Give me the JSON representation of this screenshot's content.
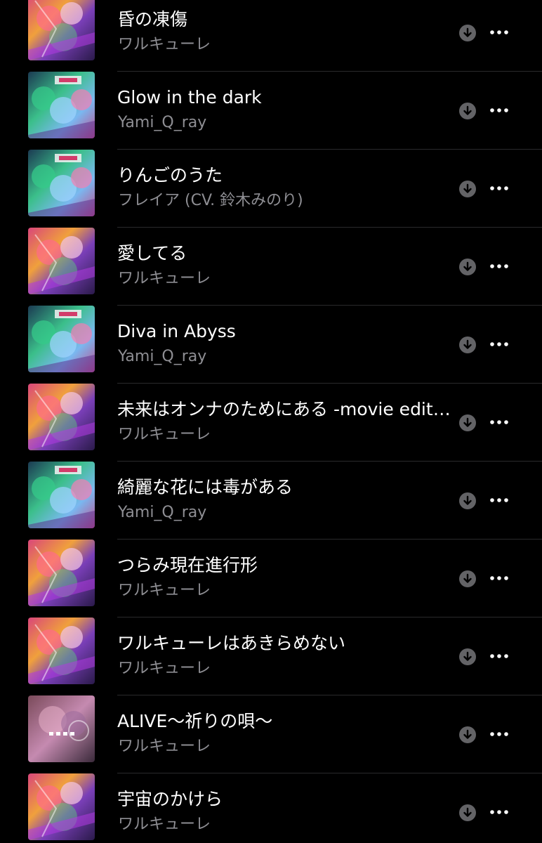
{
  "songs": [
    {
      "title": "昏の凍傷",
      "artist": "ワルキューレ",
      "art": "walkure"
    },
    {
      "title": "Glow in the dark",
      "artist": "Yami_Q_ray",
      "art": "yamiqray"
    },
    {
      "title": "りんごのうた",
      "artist": "フレイア (CV. 鈴木みのり)",
      "art": "yamiqray"
    },
    {
      "title": "愛してる",
      "artist": "ワルキューレ",
      "art": "walkure"
    },
    {
      "title": "Diva in Abyss",
      "artist": "Yami_Q_ray",
      "art": "yamiqray"
    },
    {
      "title": "未来はオンナのためにある -movie edition-",
      "artist": "ワルキューレ",
      "art": "walkure"
    },
    {
      "title": "綺麗な花には毒がある",
      "artist": "Yami_Q_ray",
      "art": "yamiqray"
    },
    {
      "title": "つらみ現在進行形",
      "artist": "ワルキューレ",
      "art": "walkure"
    },
    {
      "title": "ワルキューレはあきらめない",
      "artist": "ワルキューレ",
      "art": "walkure"
    },
    {
      "title": "ALIVE〜祈りの唄〜",
      "artist": "ワルキューレ",
      "art": "alive"
    },
    {
      "title": "宇宙のかけら",
      "artist": "ワルキューレ",
      "art": "walkure"
    }
  ],
  "icons": {
    "download": "download-icon",
    "more": "more-icon"
  },
  "colors": {
    "background": "#000000",
    "title": "#ffffff",
    "artist": "#8e8e93",
    "icon": "#636366"
  }
}
